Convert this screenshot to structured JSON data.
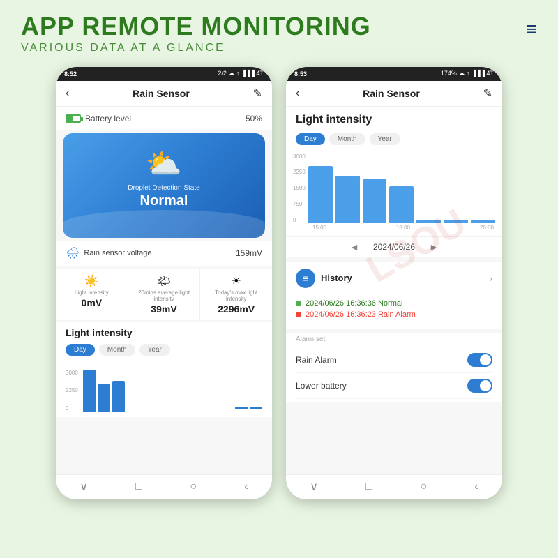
{
  "page": {
    "bg_color": "#e8f5e2",
    "title": "APP REMOTE MONITORING",
    "subtitle": "VARIOUS DATA AT A GLANCE"
  },
  "menu": {
    "icon": "≡"
  },
  "phone1": {
    "status": {
      "time": "8:52",
      "right": "2/2 ▾ ✦ ▲ ■ ■ ■ 4T"
    },
    "nav": {
      "back": "‹",
      "title": "Rain Sensor",
      "edit": "✎"
    },
    "battery": {
      "label": "Battery level",
      "value": "50%"
    },
    "weather_card": {
      "icon": "⛅",
      "label": "Droplet Detection State",
      "state": "Normal"
    },
    "rain_voltage": {
      "label": "Rain sensor voltage",
      "value": "159mV"
    },
    "intensity_cells": [
      {
        "icon": "☀",
        "label": "Light intensity",
        "value": "0mV"
      },
      {
        "icon": "⊙",
        "label": "20mins average light intensity",
        "value": "39mV"
      },
      {
        "icon": "✦",
        "label": "Today's max light intensity",
        "value": "2296mV"
      }
    ],
    "light_section": {
      "title": "Light intensity"
    },
    "tabs": [
      {
        "label": "Day",
        "active": true
      },
      {
        "label": "Month",
        "active": false
      },
      {
        "label": "Year",
        "active": false
      }
    ],
    "chart": {
      "bars": [
        60,
        40,
        45,
        0,
        0,
        0
      ],
      "lines": [
        2,
        2
      ]
    },
    "bottom_nav": [
      "∨",
      "□",
      "○",
      "‹"
    ]
  },
  "phone2": {
    "status": {
      "time": "8:53",
      "right": "174% ▾ ✦ ▲ ■ ■ ■ 4T"
    },
    "nav": {
      "back": "‹",
      "title": "Rain Sensor",
      "edit": "✎"
    },
    "section_title": "Light intensity",
    "tabs": [
      {
        "label": "Day",
        "active": true
      },
      {
        "label": "Month",
        "active": false
      },
      {
        "label": "Year",
        "active": false
      }
    ],
    "chart": {
      "y_labels": [
        "3000",
        "2250",
        "1500",
        "750",
        "0"
      ],
      "bars": [
        85,
        70,
        65,
        55,
        5,
        5,
        5
      ],
      "x_labels": [
        "15:00",
        "18:00",
        "20:00"
      ]
    },
    "date_nav": {
      "prev": "◄",
      "date": "2024/06/26",
      "next": "►"
    },
    "history": {
      "label": "History",
      "icon": "≡",
      "arrow": "›"
    },
    "history_entries": [
      {
        "type": "green",
        "text": "2024/06/26 16:36:36 Normal"
      },
      {
        "type": "red",
        "text": "2024/06/26 16:36:23 Rain Alarm"
      }
    ],
    "alarm_section": {
      "label": "Alarm set",
      "items": [
        {
          "label": "Rain Alarm",
          "enabled": true
        },
        {
          "label": "Lower battery",
          "enabled": true
        }
      ]
    },
    "bottom_nav": [
      "∨",
      "□",
      "○",
      "‹"
    ]
  },
  "watermark": "LSOU"
}
